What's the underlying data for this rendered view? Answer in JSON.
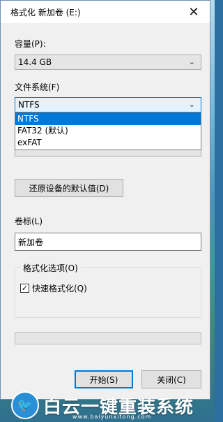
{
  "window": {
    "title": "格式化 新加卷 (E:)",
    "close_icon": "close-icon"
  },
  "capacity": {
    "label": "容量(P):",
    "value": "14.4 GB"
  },
  "filesystem": {
    "label": "文件系统(F)",
    "value": "NTFS",
    "options": [
      "NTFS",
      "FAT32 (默认)",
      "exFAT"
    ],
    "selected_index": 0
  },
  "restore_button": "还原设备的默认值(D)",
  "volume_label": {
    "label": "卷标(L)",
    "value": "新加卷"
  },
  "format_options": {
    "legend": "格式化选项(O)",
    "quick_format": {
      "label": "快速格式化(Q)",
      "checked": true
    }
  },
  "progress": {
    "fraction": 0
  },
  "buttons": {
    "start": "开始(S)",
    "close": "关闭(C)"
  },
  "watermark": {
    "brand": "白云一键重装系统",
    "url": "www.baiyunxitong.com",
    "icon": "twitter-bird-icon"
  },
  "colors": {
    "accent": "#0078d7",
    "dialog_bg": "#f0f0f0"
  }
}
